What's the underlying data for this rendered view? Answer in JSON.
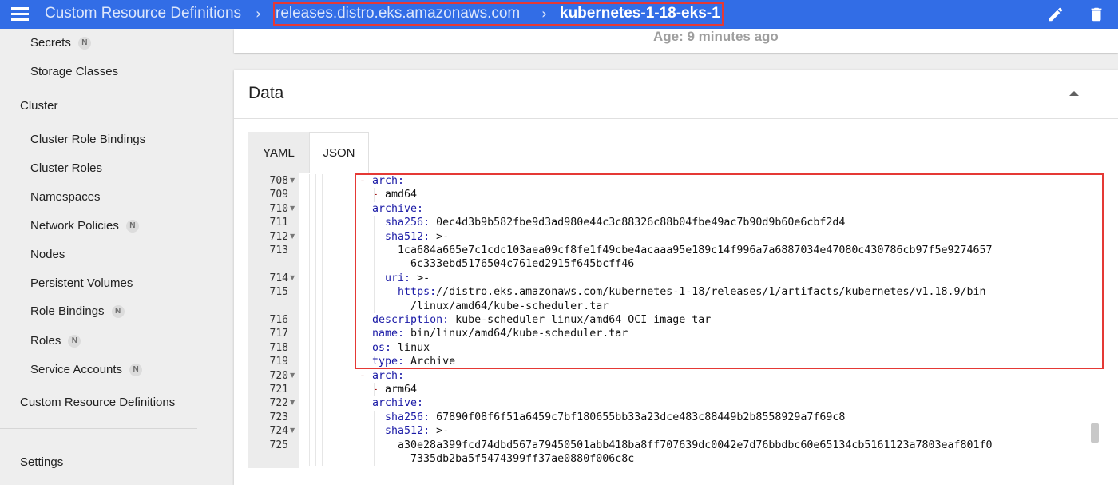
{
  "header": {
    "root": "Custom Resource Definitions",
    "group": "releases.distro.eks.amazonaws.com",
    "resource": "kubernetes-1-18-eks-1",
    "edit_icon": "pencil-icon",
    "delete_icon": "trash-icon"
  },
  "sidebar": {
    "items_top": [
      {
        "label": "Secrets",
        "badge": "N"
      },
      {
        "label": "Storage Classes",
        "badge": ""
      }
    ],
    "cluster_heading": "Cluster",
    "cluster_items": [
      {
        "label": "Cluster Role Bindings",
        "badge": ""
      },
      {
        "label": "Cluster Roles",
        "badge": ""
      },
      {
        "label": "Namespaces",
        "badge": ""
      },
      {
        "label": "Network Policies",
        "badge": "N"
      },
      {
        "label": "Nodes",
        "badge": ""
      },
      {
        "label": "Persistent Volumes",
        "badge": ""
      },
      {
        "label": "Role Bindings",
        "badge": "N"
      },
      {
        "label": "Roles",
        "badge": "N"
      },
      {
        "label": "Service Accounts",
        "badge": "N"
      }
    ],
    "crd_heading": "Custom Resource Definitions",
    "settings_heading": "Settings"
  },
  "metadata": {
    "age": "Age: 9 minutes ago"
  },
  "data_card": {
    "title": "Data",
    "tabs": [
      "YAML",
      "JSON"
    ],
    "active_tab": "JSON",
    "lines": [
      {
        "n": "708",
        "fold": true,
        "indent": 0,
        "text": "- arch:"
      },
      {
        "n": "709",
        "fold": false,
        "indent": 1,
        "text": "  - amd64"
      },
      {
        "n": "710",
        "fold": true,
        "indent": 0,
        "text": "  archive:"
      },
      {
        "n": "711",
        "fold": false,
        "indent": 1,
        "text": "    sha256: 0ec4d3b9b582fbe9d3ad980e44c3c88326c88b04fbe49ac7b90d9b60e6cbf2d4"
      },
      {
        "n": "712",
        "fold": true,
        "indent": 1,
        "text": "    sha512: >-"
      },
      {
        "n": "713",
        "fold": false,
        "indent": 2,
        "text": "      1ca684a665e7c1cdc103aea09cf8fe1f49cbe4acaaa95e189c14f996a7a6887034e47080c430786cb97f5e9274657"
      },
      {
        "n": "",
        "fold": false,
        "indent": 2,
        "text": "        6c333ebd5176504c761ed2915f645bcff46"
      },
      {
        "n": "714",
        "fold": true,
        "indent": 1,
        "text": "    uri: >-"
      },
      {
        "n": "715",
        "fold": false,
        "indent": 2,
        "text": "      https://distro.eks.amazonaws.com/kubernetes-1-18/releases/1/artifacts/kubernetes/v1.18.9/bin"
      },
      {
        "n": "",
        "fold": false,
        "indent": 2,
        "text": "        /linux/amd64/kube-scheduler.tar"
      },
      {
        "n": "716",
        "fold": false,
        "indent": 0,
        "text": "  description: kube-scheduler linux/amd64 OCI image tar"
      },
      {
        "n": "717",
        "fold": false,
        "indent": 0,
        "text": "  name: bin/linux/amd64/kube-scheduler.tar"
      },
      {
        "n": "718",
        "fold": false,
        "indent": 0,
        "text": "  os: linux"
      },
      {
        "n": "719",
        "fold": false,
        "indent": 0,
        "text": "  type: Archive"
      },
      {
        "n": "720",
        "fold": true,
        "indent": 0,
        "text": "- arch:"
      },
      {
        "n": "721",
        "fold": false,
        "indent": 1,
        "text": "  - arm64"
      },
      {
        "n": "722",
        "fold": true,
        "indent": 0,
        "text": "  archive:"
      },
      {
        "n": "723",
        "fold": false,
        "indent": 1,
        "text": "    sha256: 67890f08f6f51a6459c7bf180655bb33a23dce483c88449b2b8558929a7f69c8"
      },
      {
        "n": "724",
        "fold": true,
        "indent": 1,
        "text": "    sha512: >-"
      },
      {
        "n": "725",
        "fold": false,
        "indent": 2,
        "text": "      a30e28a399fcd74dbd567a79450501abb418ba8ff707639dc0042e7d76bbdbc60e65134cb5161123a7803eaf801f0"
      },
      {
        "n": "",
        "fold": false,
        "indent": 2,
        "text": "        7335db2ba5f5474399ff37ae0880f006c8c"
      }
    ]
  },
  "colors": {
    "topbar": "#326de6",
    "highlight": "#e53935",
    "yaml_key": "#1a1aa6",
    "yaml_dash": "#a31515"
  }
}
